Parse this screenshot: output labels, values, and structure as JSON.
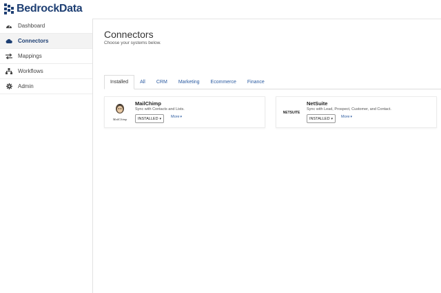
{
  "brand": {
    "name": "BedrockData",
    "color": "#1e3f73"
  },
  "sidebar": {
    "items": [
      {
        "label": "Dashboard",
        "icon": "dashboard-icon",
        "active": false
      },
      {
        "label": "Connectors",
        "icon": "cloud-icon",
        "active": true
      },
      {
        "label": "Mappings",
        "icon": "exchange-icon",
        "active": false
      },
      {
        "label": "Workflows",
        "icon": "sitemap-icon",
        "active": false
      },
      {
        "label": "Admin",
        "icon": "gear-icon",
        "active": false
      }
    ]
  },
  "page": {
    "title": "Connectors",
    "subtitle": "Choose your systems below."
  },
  "tabs": [
    {
      "label": "Installed",
      "active": true
    },
    {
      "label": "All",
      "active": false
    },
    {
      "label": "CRM",
      "active": false
    },
    {
      "label": "Marketing",
      "active": false
    },
    {
      "label": "Ecommerce",
      "active": false
    },
    {
      "label": "Finance",
      "active": false
    }
  ],
  "connectors": [
    {
      "name": "MailChimp",
      "logo_text": "MailChimp",
      "description": "Sync with Contacts and Lists.",
      "status": "INSTALLED",
      "more": "More"
    },
    {
      "name": "NetSuite",
      "logo_text": "NETSUITE",
      "description": "Sync with Lead, Prospect, Customer, and Contact.",
      "status": "INSTALLED",
      "more": "More"
    }
  ],
  "colors": {
    "link": "#2a5aa0",
    "text": "#333333"
  }
}
